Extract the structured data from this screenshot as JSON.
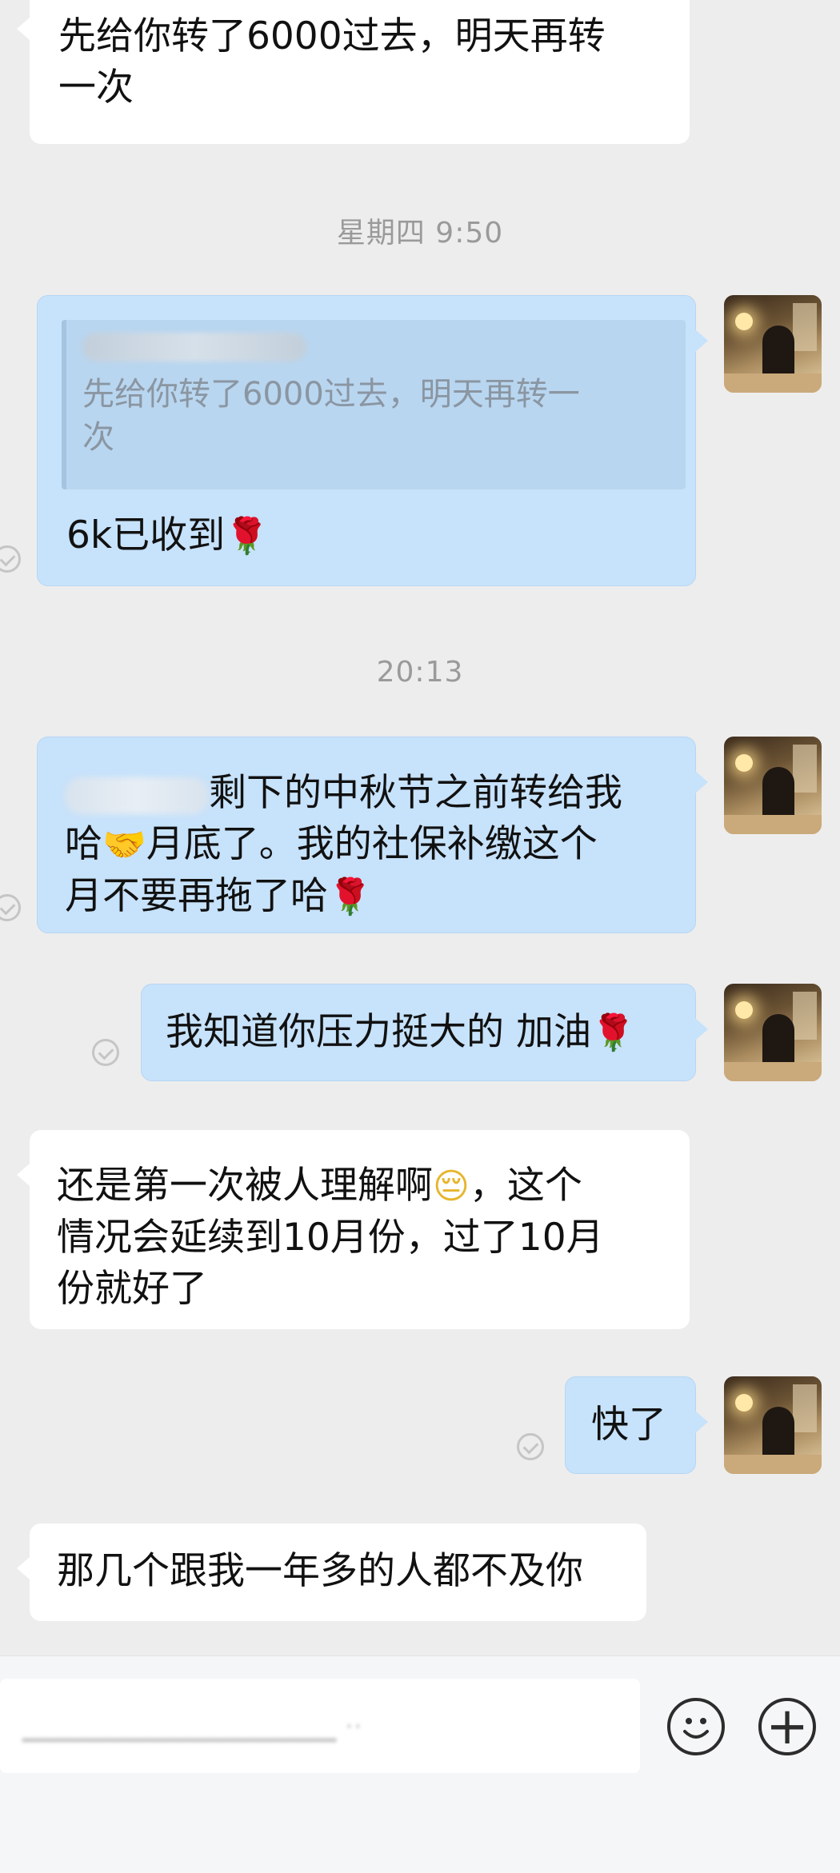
{
  "messages": {
    "m1": {
      "line1": "先给你转了6000过去，明天再转",
      "line2": "一次"
    },
    "ts1": "星期四 9:50",
    "m2": {
      "quote_line1": "先给你转了6000过去，明天再转一",
      "quote_line2": "次",
      "text": "6k已收到"
    },
    "ts2": "20:13",
    "m3": {
      "line1_rest": "剩下的中秋节之前转给我",
      "line2_a": "哈",
      "line2_b": "月底了。我的社保补缴这个",
      "line3": "月不要再拖了哈"
    },
    "m4": {
      "text": "我知道你压力挺大的 加油"
    },
    "m5": {
      "line1_a": "还是第一次被人理解啊",
      "line1_b": "，这个",
      "line2": "情况会延续到10月份，过了10月",
      "line3": "份就好了"
    },
    "m6": {
      "text": "快了"
    },
    "m7": {
      "text": "那几个跟我一年多的人都不及你"
    }
  },
  "icons": {
    "rose": "rose-emoji",
    "handshake": "handshake-emoji",
    "face": "worried-face-emoji",
    "check": "read-check-icon",
    "emoji_button": "smiley-icon",
    "plus_button": "plus-icon"
  },
  "glyphs": {
    "rose": "🌹",
    "handshake": "🤝",
    "face": "😔",
    "plus": "+"
  },
  "colors": {
    "incoming": "#ffffff",
    "outgoing": "#c7e2fb",
    "background": "#ededed"
  }
}
